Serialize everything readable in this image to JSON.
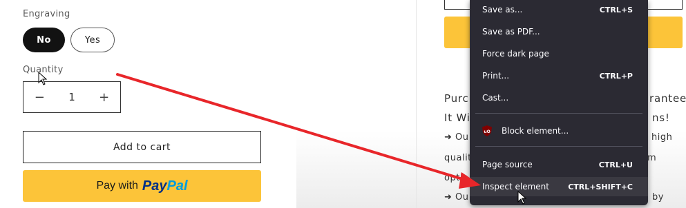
{
  "product": {
    "engraving_label": "Engraving",
    "engraving_options": [
      "No",
      "Yes"
    ],
    "quantity_label": "Quantity",
    "quantity_minus": "−",
    "quantity_value": "1",
    "quantity_plus": "+",
    "add_to_cart_label": "Add to cart",
    "paypal_prefix": "Pay with",
    "paypal_pay": "Pay",
    "paypal_pal": "Pal"
  },
  "page_right": {
    "lines": [
      {
        "left": "Purch",
        "right": "rantee :"
      },
      {
        "left": "It Wi",
        "right": "ns!"
      },
      {
        "left": "➜ Ou",
        "right": "high"
      },
      {
        "left": "qualit",
        "right": "m"
      },
      {
        "left": "optio",
        "right": ""
      },
      {
        "left": "➜ Ou",
        "right": "by"
      }
    ]
  },
  "context_menu": {
    "items": [
      {
        "label": "Save as...",
        "shortcut": "CTRL+S"
      },
      {
        "label": "Save as PDF...",
        "shortcut": ""
      },
      {
        "label": "Force dark page",
        "shortcut": ""
      },
      {
        "label": "Print...",
        "shortcut": "CTRL+P"
      },
      {
        "label": "Cast...",
        "shortcut": ""
      },
      {
        "label": "Block element...",
        "shortcut": ""
      },
      {
        "label": "Page source",
        "shortcut": "CTRL+U"
      },
      {
        "label": "Inspect element",
        "shortcut": "CTRL+SHIFT+C"
      }
    ],
    "ublock_icon_text": "uO"
  },
  "colors": {
    "menu_bg": "#2b2a33",
    "paypal_yellow": "#fcc439",
    "arrow_red": "#e8262a",
    "paypal_dark_blue": "#003087",
    "paypal_light_blue": "#009cde"
  }
}
